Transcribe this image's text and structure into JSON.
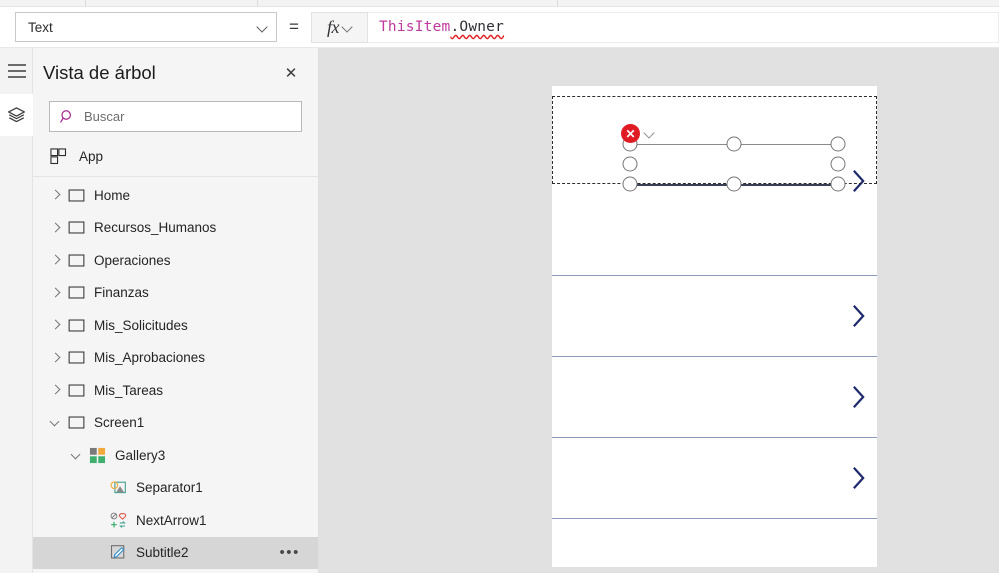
{
  "formula_bar": {
    "property_select": {
      "value": "Text",
      "icon": "chevron-down-icon"
    },
    "equals": "=",
    "fx_label": "fx",
    "formula_token_identifier": "ThisItem",
    "formula_token_member": ".Owner",
    "formula_full": "ThisItem.Owner"
  },
  "rail": {
    "menu_icon": "hamburger-icon",
    "layers_icon": "layers-icon"
  },
  "treeview": {
    "title": "Vista de árbol",
    "close_icon": "close-icon",
    "search": {
      "placeholder": "Buscar",
      "value": "",
      "icon": "search-icon"
    },
    "app_row": {
      "label": "App",
      "icon": "app-grid-icon"
    },
    "items": [
      {
        "label": "Home",
        "icon": "screen-icon",
        "expander": "chevron-right-icon",
        "indent": 0,
        "selected": false
      },
      {
        "label": "Recursos_Humanos",
        "icon": "screen-icon",
        "expander": "chevron-right-icon",
        "indent": 0,
        "selected": false
      },
      {
        "label": "Operaciones",
        "icon": "screen-icon",
        "expander": "chevron-right-icon",
        "indent": 0,
        "selected": false
      },
      {
        "label": "Finanzas",
        "icon": "screen-icon",
        "expander": "chevron-right-icon",
        "indent": 0,
        "selected": false
      },
      {
        "label": "Mis_Solicitudes",
        "icon": "screen-icon",
        "expander": "chevron-right-icon",
        "indent": 0,
        "selected": false
      },
      {
        "label": "Mis_Aprobaciones",
        "icon": "screen-icon",
        "expander": "chevron-right-icon",
        "indent": 0,
        "selected": false
      },
      {
        "label": "Mis_Tareas",
        "icon": "screen-icon",
        "expander": "chevron-right-icon",
        "indent": 0,
        "selected": false
      },
      {
        "label": "Screen1",
        "icon": "screen-icon",
        "expander": "chevron-down-icon",
        "indent": 0,
        "selected": false
      },
      {
        "label": "Gallery3",
        "icon": "gallery-icon",
        "expander": "chevron-down-icon",
        "indent": 1,
        "selected": false
      },
      {
        "label": "Separator1",
        "icon": "image-icon",
        "expander": "none",
        "indent": 2,
        "selected": false
      },
      {
        "label": "NextArrow1",
        "icon": "icon-set-icon",
        "expander": "none",
        "indent": 2,
        "selected": false
      },
      {
        "label": "Subtitle2",
        "icon": "label-edit-icon",
        "expander": "none",
        "indent": 2,
        "selected": true,
        "more_label": "•••"
      }
    ]
  },
  "canvas": {
    "gallery": {
      "selected_outline": "dashed",
      "rows": [
        {
          "chevron": "next-arrow-icon"
        },
        {
          "chevron": "next-arrow-icon"
        },
        {
          "chevron": "next-arrow-icon"
        },
        {
          "chevron": "next-arrow-icon"
        }
      ]
    },
    "selection": {
      "error_badge_icon": "error-x-icon",
      "error_badge_glyph": "✕",
      "error_chevron_icon": "chevron-down-icon",
      "handles": 8
    }
  },
  "colors": {
    "accent_purple": "#a4268f",
    "formula_identifier": "#c0399f",
    "error_red": "#e01b24",
    "chevron_navy": "#1f2a6e",
    "separator_blue": "#8d9ac0",
    "canvas_bg": "#e1e1e1",
    "panel_bg": "#f5f5f5",
    "selected_row": "#d6d6d6"
  }
}
